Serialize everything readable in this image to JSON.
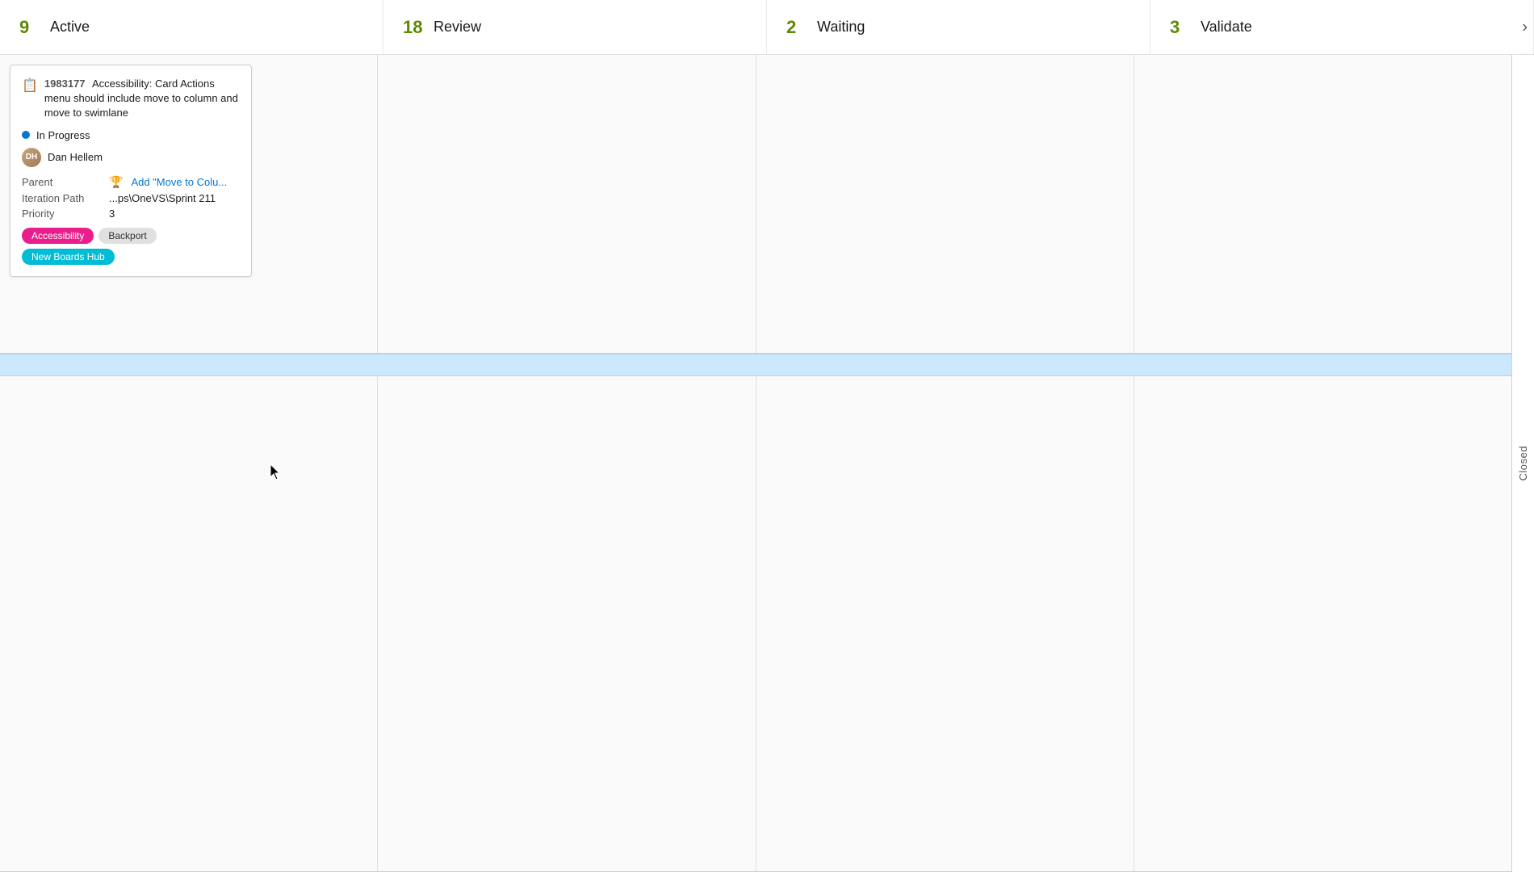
{
  "columns": [
    {
      "id": "active",
      "title": "Active",
      "count": "9"
    },
    {
      "id": "review",
      "title": "Review",
      "count": "18"
    },
    {
      "id": "waiting",
      "title": "Waiting",
      "count": "2"
    },
    {
      "id": "validate",
      "title": "Validate",
      "count": "3"
    }
  ],
  "chevron": "›",
  "closed_label": "Closed",
  "card": {
    "icon": "📋",
    "id": "1983177",
    "title": "Accessibility: Card Actions menu should include move to column and move to swimlane",
    "status": "In Progress",
    "status_color": "#0078d4",
    "assignee": "Dan Hellem",
    "parent_label": "Parent",
    "parent_icon": "🏆",
    "parent_value": "Add \"Move to Colu...",
    "iteration_label": "Iteration Path",
    "iteration_value": "...ps\\OneVS\\Sprint 211",
    "priority_label": "Priority",
    "priority_value": "3",
    "tags": [
      {
        "label": "Accessibility",
        "class": "tag-accessibility"
      },
      {
        "label": "Backport",
        "class": "tag-backport"
      },
      {
        "label": "New Boards Hub",
        "class": "tag-new-boards-hub"
      }
    ]
  }
}
